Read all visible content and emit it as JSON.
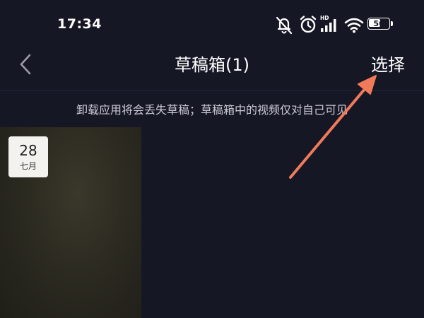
{
  "status_bar": {
    "time": "17:34",
    "battery_level": "56",
    "battery_fraction": 0.56,
    "signal_label": "HD",
    "icons": [
      "mute-icon",
      "alarm-icon",
      "signal-icon",
      "wifi-icon",
      "battery-icon"
    ]
  },
  "nav": {
    "back_icon": "chevron-left-icon",
    "title": "草稿箱(1)",
    "select_label": "选择"
  },
  "notice": "卸载应用将会丢失草稿；草稿箱中的视频仅对自己可见",
  "drafts": [
    {
      "day": "28",
      "month": "七月"
    }
  ],
  "colors": {
    "background": "#161725",
    "text": "#ffffff",
    "notice_text": "#c9cad4",
    "annotation_arrow": "#f07a5a"
  }
}
